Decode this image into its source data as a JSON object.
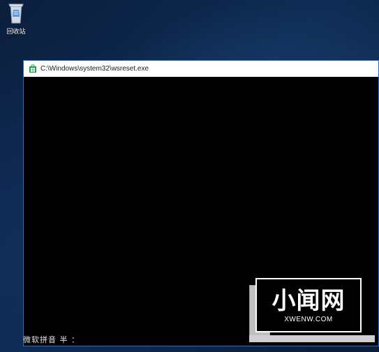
{
  "desktop": {
    "recycle_bin_label": "回收站"
  },
  "window": {
    "title": "C:\\Windows\\system32\\wsreset.exe"
  },
  "ime": {
    "status_text": "微软拼音 半 ："
  },
  "watermark": {
    "title": "小闻网",
    "subtitle": "XWENW.COM"
  },
  "colors": {
    "desktop_bg": "#0d2a52",
    "console_bg": "#000000",
    "window_border": "#2a6ac8",
    "titlebar_bg": "#ffffff"
  },
  "icons": {
    "recycle_bin": "recycle-bin-icon",
    "store": "store-icon"
  }
}
